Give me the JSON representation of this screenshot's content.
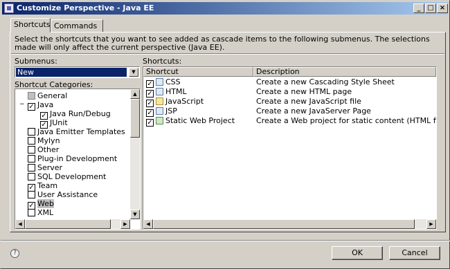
{
  "window": {
    "title": "Customize Perspective - Java EE"
  },
  "tabs": [
    {
      "label": "Shortcuts",
      "active": true
    },
    {
      "label": "Commands",
      "active": false
    }
  ],
  "description": "Select the shortcuts that you want to see added as cascade items to the following submenus.  The selections made will only affect the current perspective (Java EE).",
  "submenus": {
    "label": "Submenus:",
    "selected": "New"
  },
  "categories": {
    "label": "Shortcut Categories:",
    "items": [
      {
        "label": "General",
        "checked": "gray"
      },
      {
        "label": "Java",
        "checked": "yes"
      },
      {
        "label": "Java Run/Debug",
        "checked": "yes"
      },
      {
        "label": "JUnit",
        "checked": "yes"
      },
      {
        "label": "Java Emitter Templates",
        "checked": "no"
      },
      {
        "label": "Mylyn",
        "checked": "no"
      },
      {
        "label": "Other",
        "checked": "no"
      },
      {
        "label": "Plug-in Development",
        "checked": "no"
      },
      {
        "label": "Server",
        "checked": "no"
      },
      {
        "label": "SQL Development",
        "checked": "no"
      },
      {
        "label": "Team",
        "checked": "yes"
      },
      {
        "label": "User Assistance",
        "checked": "no"
      },
      {
        "label": "Web",
        "checked": "yes"
      },
      {
        "label": "XML",
        "checked": "no"
      }
    ]
  },
  "shortcuts": {
    "label": "Shortcuts:",
    "columns": [
      "Shortcut",
      "Description"
    ],
    "rows": [
      {
        "name": "CSS",
        "description": "Create a new Cascading Style Sheet",
        "checked": true
      },
      {
        "name": "HTML",
        "description": "Create a new HTML page",
        "checked": true
      },
      {
        "name": "JavaScript",
        "description": "Create a new JavaScript file",
        "checked": true
      },
      {
        "name": "JSP",
        "description": "Create a new JavaServer Page",
        "checked": true
      },
      {
        "name": "Static Web Project",
        "description": "Create a Web project for static content (HTML files) on",
        "checked": true
      }
    ]
  },
  "buttons": {
    "ok": "OK",
    "cancel": "Cancel"
  },
  "icons": {
    "help": "help-icon",
    "window": "window-icon"
  }
}
